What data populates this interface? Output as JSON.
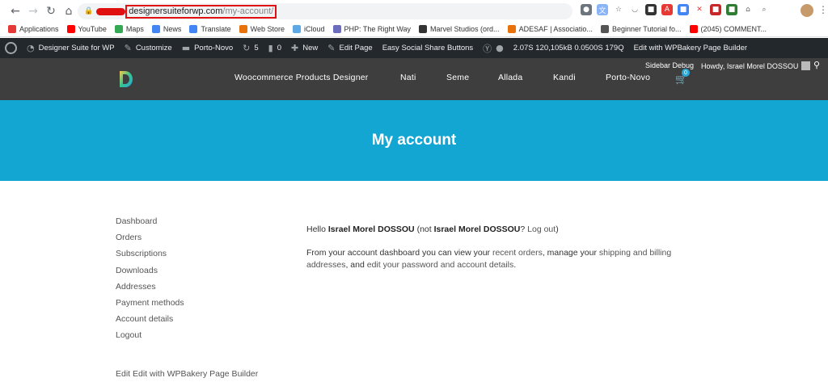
{
  "browser": {
    "url_host": "designersuiteforwp.com",
    "url_path": "/my-account/"
  },
  "bookmarks": [
    {
      "label": "Applications",
      "color": "#e53935"
    },
    {
      "label": "YouTube",
      "color": "#ff0000"
    },
    {
      "label": "Maps",
      "color": "#34a853"
    },
    {
      "label": "News",
      "color": "#4285f4"
    },
    {
      "label": "Translate",
      "color": "#4285f4"
    },
    {
      "label": "Web Store",
      "color": "#e8710a"
    },
    {
      "label": "iCloud",
      "color": "#5aa9e6"
    },
    {
      "label": "PHP: The Right Way",
      "color": "#6c6cbf"
    },
    {
      "label": "Marvel Studios (ord...",
      "color": "#333333"
    },
    {
      "label": "ADESAF | Associatio...",
      "color": "#e8710a"
    },
    {
      "label": "Beginner Tutorial fo...",
      "color": "#555555"
    },
    {
      "label": "(2045) COMMENT...",
      "color": "#ff0000"
    }
  ],
  "admin_bar": {
    "site_name": "Designer Suite for WP",
    "customize": "Customize",
    "porto_novo": "Porto-Novo",
    "updates": "5",
    "comments": "0",
    "new": "New",
    "edit_page": "Edit Page",
    "social": "Easy Social Share Buttons",
    "stats": "2.07S  120,105kB  0.0500S  179Q",
    "wpbakery": "Edit with WPBakery Page Builder"
  },
  "header": {
    "sidebar_debug": "Sidebar Debug",
    "howdy": "Howdy, Israel Morel DOSSOU",
    "cart_count": "0",
    "nav": [
      "Woocommerce Products Designer",
      "Nati",
      "Seme",
      "Allada",
      "Kandi",
      "Porto-Novo"
    ]
  },
  "hero": {
    "title": "My account"
  },
  "account_nav": [
    "Dashboard",
    "Orders",
    "Subscriptions",
    "Downloads",
    "Addresses",
    "Payment methods",
    "Account details",
    "Logout"
  ],
  "content": {
    "hello": "Hello ",
    "user": "Israel Morel DOSSOU",
    "not": " (not ",
    "user2": "Israel Morel DOSSOU",
    "logout_q": "? ",
    "logout": "Log out",
    "close": ")",
    "p2_a": "From your account dashboard you can view your ",
    "recent_orders": "recent orders",
    "p2_b": ", manage your ",
    "addresses": "shipping and billing addresses",
    "p2_c": ", and ",
    "edit_details": "edit your password and account details",
    "p2_d": "."
  },
  "footer": {
    "edit": "Edit Edit with WPBakery Page Builder"
  },
  "colors": {
    "hero": "#14a6d3",
    "header": "#3e3e3e",
    "admin_bar": "#23282d",
    "highlight": "#e01010"
  }
}
